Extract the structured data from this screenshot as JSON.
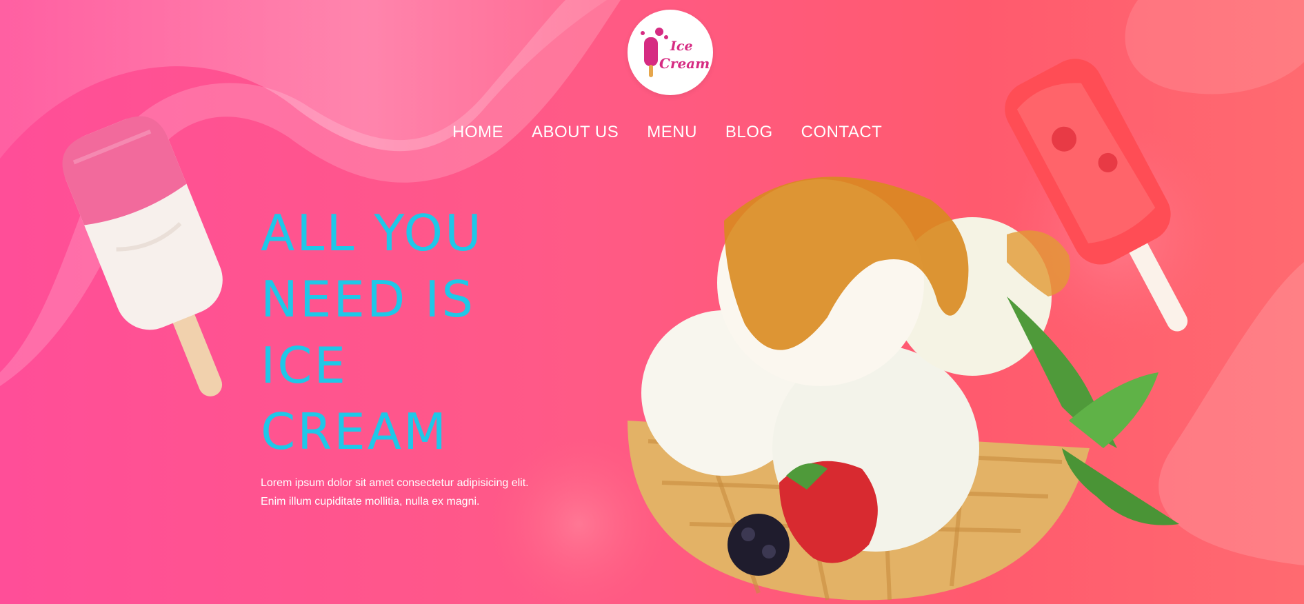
{
  "logo": {
    "line1": "Ice",
    "line2": "Cream"
  },
  "nav": {
    "items": [
      {
        "label": "HOME"
      },
      {
        "label": "ABOUT US"
      },
      {
        "label": "MENU"
      },
      {
        "label": "BLOG"
      },
      {
        "label": "CONTACT"
      }
    ]
  },
  "hero": {
    "title_lines": [
      "ALL YOU",
      "NEED IS",
      "ICE",
      "CREAM"
    ],
    "copy_line1": "Lorem ipsum dolor sit amet consectetur adipisicing elit.",
    "copy_line2": "Enim illum cupiditate mollitia, nulla ex magni."
  },
  "colors": {
    "background_start": "#ff4e98",
    "background_end": "#ff6a70",
    "title": "#1ec8e8",
    "logo_text": "#d62b82"
  },
  "images": {
    "left": "pink-white-popsicle",
    "right": "red-popsicle",
    "center": "ice-cream-scoops-in-waffle-bowl"
  }
}
